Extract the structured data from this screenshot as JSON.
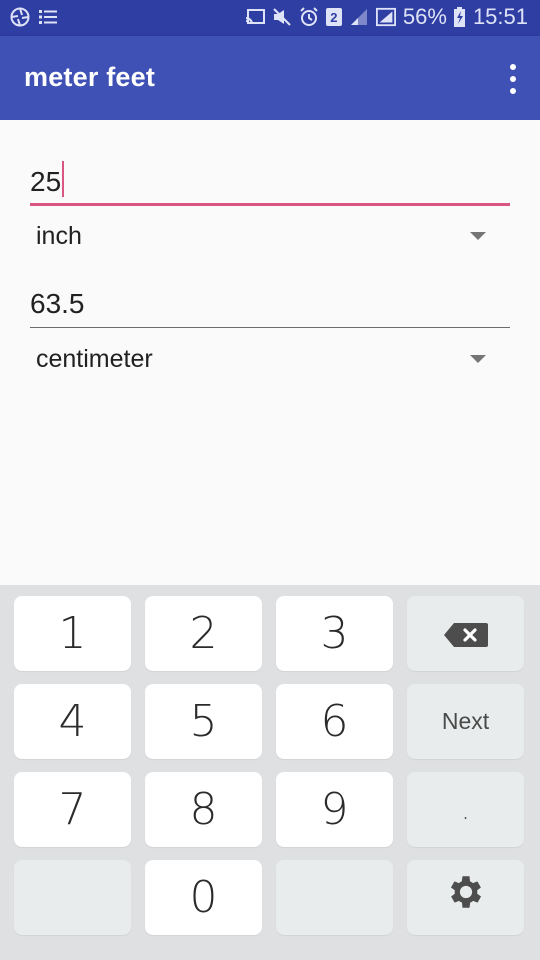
{
  "status_bar": {
    "left_icons": [
      "aperture-icon",
      "list-icon"
    ],
    "right_icons": [
      "cast-icon",
      "mute-icon",
      "alarm-icon",
      "sim2-icon",
      "signal-weak-icon",
      "signal-icon"
    ],
    "sim_label": "2",
    "battery": "56%",
    "time": "15:51"
  },
  "app_bar": {
    "title": "meter feet",
    "overflow_icon": "more-vert-icon"
  },
  "converter": {
    "input_value": "25",
    "input_unit": "inch",
    "output_value": "63.5",
    "output_unit": "centimeter",
    "accent_color": "#d8567f",
    "primary_color": "#3f51b5"
  },
  "keyboard": {
    "keys": [
      "1",
      "2",
      "3",
      "4",
      "5",
      "6",
      "7",
      "8",
      "9",
      "0",
      "."
    ],
    "next_label": "Next",
    "backspace_icon": "backspace-icon",
    "settings_icon": "gear-icon"
  }
}
